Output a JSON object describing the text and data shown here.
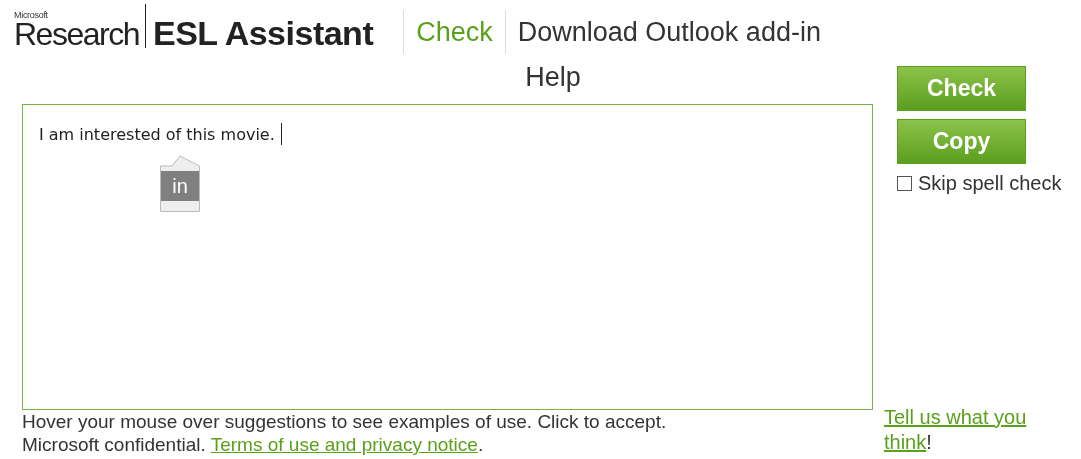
{
  "logo": {
    "company": "Microsoft",
    "division": "Research",
    "product": "ESL Assistant"
  },
  "nav": [
    {
      "label": "Check",
      "selected": true
    },
    {
      "label": "Download Outlook add-in",
      "selected": false
    },
    {
      "label": "Help",
      "selected": false
    }
  ],
  "editor": {
    "text": "I am interested of this movie.",
    "suggestion": "in"
  },
  "buttons": [
    "Check",
    "Copy"
  ],
  "skip_spell_check": {
    "label": "Skip spell check",
    "checked": false
  },
  "footer": {
    "hint": "Hover your mouse over suggestions to see examples of use. Click to accept.",
    "confidential": "Microsoft confidential. ",
    "terms_link": "Terms of use and privacy notice",
    "terms_suffix": ".",
    "feedback_link": [
      "Tell us what you",
      "think"
    ],
    "feedback_suffix": "!"
  }
}
